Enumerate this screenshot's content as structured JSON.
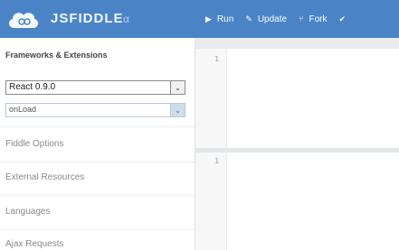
{
  "header": {
    "brand_name": "JSFIDDLE",
    "brand_sep": "α",
    "menu": [
      {
        "icon": "play-icon",
        "glyph": "▶",
        "label": "Run"
      },
      {
        "icon": "pencil-icon",
        "glyph": "✎",
        "label": "Update"
      },
      {
        "icon": "fork-icon",
        "glyph": "⑂",
        "label": "Fork"
      },
      {
        "icon": "check-icon",
        "glyph": "✔",
        "label": ""
      }
    ]
  },
  "sidebar": {
    "title": "Frameworks & Extensions",
    "framework_select": {
      "value": "React 0.9.0",
      "arrow": "⌄"
    },
    "extension_select": {
      "value": "onLoad",
      "arrow": "⌄"
    },
    "sections": [
      "Fiddle Options",
      "External Resources",
      "Languages",
      "Ajax Requests"
    ]
  },
  "editor": {
    "panes": [
      {
        "line": "1"
      },
      {
        "line": "1"
      }
    ]
  },
  "colors": {
    "header_bg": "#4a84c7",
    "sidebar_bg": "#ffffff",
    "editor_bg": "#e9ebee"
  }
}
